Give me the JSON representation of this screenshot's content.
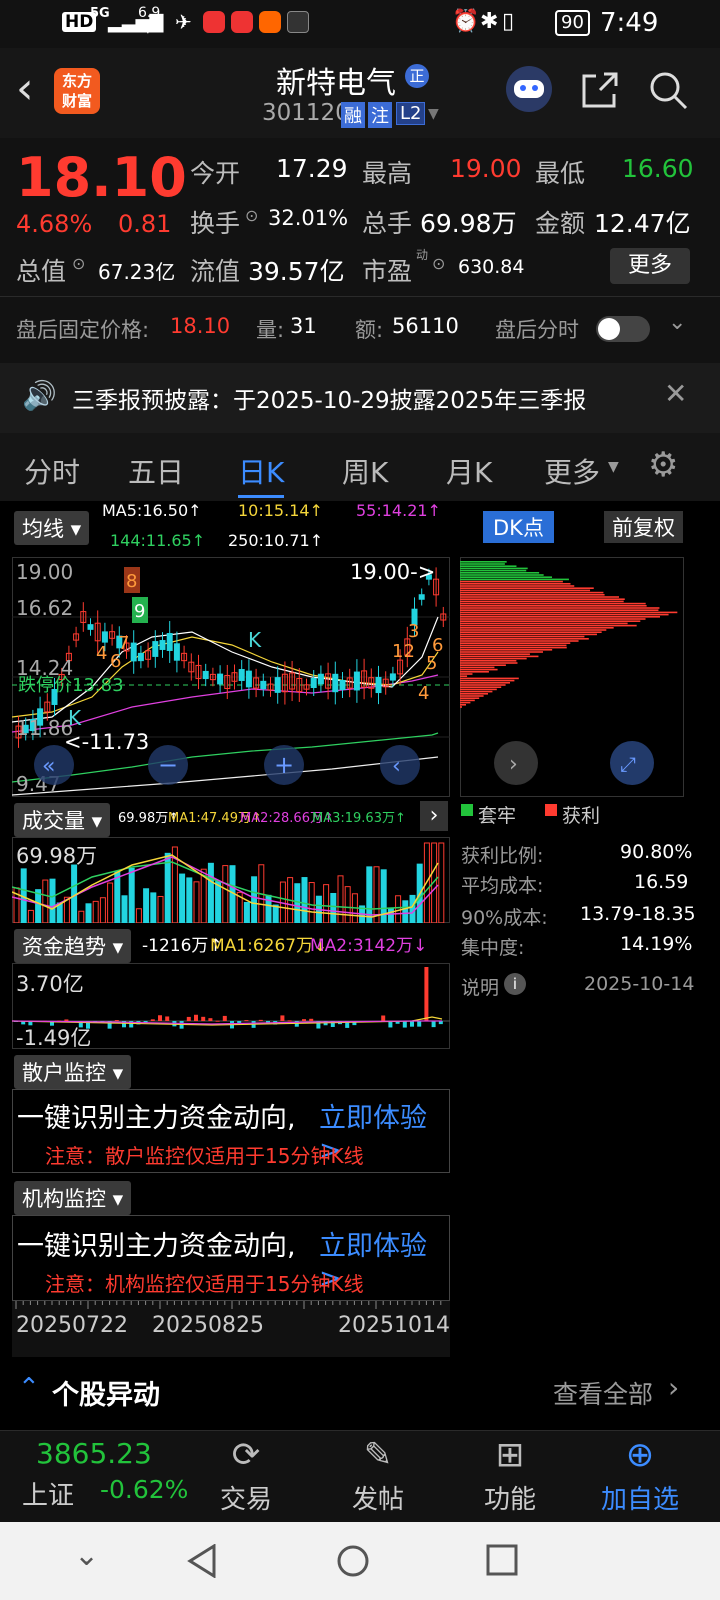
{
  "status": {
    "net": "5G",
    "speed": "6.9 K/s",
    "battery": "90",
    "time": "7:49"
  },
  "header": {
    "logo_line1": "东方",
    "logo_line2": "财富",
    "stock_name": "新特电气",
    "badge": "正",
    "code": "301120",
    "tag_rong": "融",
    "tag_zhu": "注",
    "tag_l2": "L2"
  },
  "quote": {
    "price": "18.10",
    "pct": "4.68%",
    "change": "0.81",
    "open_label": "今开",
    "open": "17.29",
    "high_label": "最高",
    "high": "19.00",
    "low_label": "最低",
    "low": "16.60",
    "turnover_label": "换手",
    "turnover": "32.01%",
    "volume_label": "总手",
    "volume": "69.98万",
    "amount_label": "金额",
    "amount": "12.47亿",
    "mktcap_label": "总值",
    "mktcap": "67.23亿",
    "float_label": "流值",
    "float": "39.57亿",
    "pe_label": "市盈",
    "pe_sup": "动",
    "pe": "630.84",
    "more_button": "更多",
    "after_label": "盘后固定价格:",
    "after_price": "18.10",
    "after_vol_label": "量:",
    "after_vol": "31",
    "after_amt_label": "额:",
    "after_amt": "56110",
    "after_time_label": "盘后分时"
  },
  "notice": {
    "text": "三季报预披露：于2025-10-29披露2025年三季报"
  },
  "tabs": [
    "分时",
    "五日",
    "日K",
    "周K",
    "月K",
    "更多"
  ],
  "chart": {
    "ma_select": "均线",
    "ma5": "MA5:16.50↑",
    "ma10": "10:15.14↑",
    "ma55": "55:14.21↑",
    "ma144": "144:11.65↑",
    "ma250": "250:10.71↑",
    "dk_button": "DK点",
    "fq_button": "前复权",
    "y_ticks": [
      "19.00",
      "16.62",
      "14.24",
      "11.86",
      "9.47"
    ],
    "limit_label": "跌停价13.83",
    "high_mark": "19.00->",
    "low_mark": "<-11.73",
    "vol_select": "成交量",
    "vol_line": "69.98万↑",
    "vol_ma1": "MA1:47.49万↑",
    "vol_ma2": "MA2:28.66万↑",
    "vol_ma3": "MA3:19.63万↑",
    "vol_top": "69.98万",
    "fund_select": "资金趋势",
    "fund_val": "-1216万↑",
    "fund_ma1": "MA1:6267万↓",
    "fund_ma2": "MA2:3142万↓",
    "fund_top": "3.70亿",
    "fund_bottom": "-1.49亿",
    "retail_select": "散户监控",
    "retail_text": "一键识别主力资金动向,",
    "retail_link": "立即体验>",
    "retail_note": "注意：散户监控仅适用于15分钟K线",
    "inst_select": "机构监控",
    "inst_text": "一键识别主力资金动向,",
    "inst_link": "立即体验>",
    "inst_note": "注意：机构监控仅适用于15分钟K线",
    "dates": [
      "20250722",
      "20250825",
      "20251014"
    ]
  },
  "chip_dist": {
    "legend_trapped": "套牢",
    "legend_profit": "获利",
    "profit_ratio_label": "获利比例:",
    "profit_ratio": "90.80%",
    "avg_cost_label": "平均成本:",
    "avg_cost": "16.59",
    "cost90_label": "90%成本:",
    "cost90": "13.79-18.35",
    "concentration_label": "集中度:",
    "concentration": "14.19%",
    "explain": "说明",
    "date": "2025-10-14"
  },
  "section": {
    "title": "个股异动",
    "view_all": "查看全部"
  },
  "bottom": {
    "index_value": "3865.23",
    "index_name": "上证",
    "index_pct": "-0.62%",
    "trade": "交易",
    "post": "发帖",
    "function": "功能",
    "add": "加自选"
  },
  "colors": {
    "up": "#ff3b30",
    "down": "#22c33b",
    "accent": "#3c8cff"
  }
}
